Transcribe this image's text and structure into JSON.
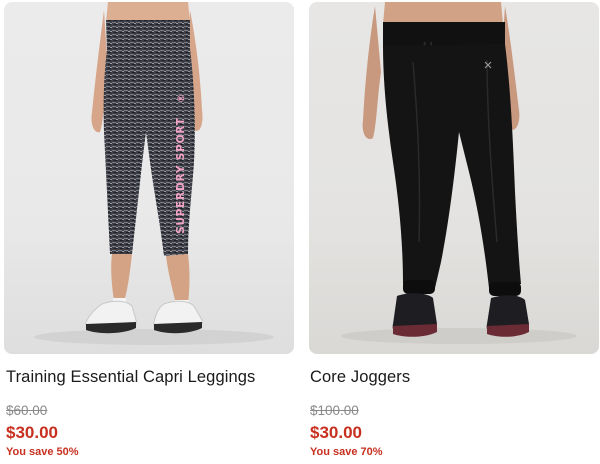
{
  "products": [
    {
      "name": "Training Essential Capri Leggings",
      "was_price": "$60.00",
      "price": "$30.00",
      "savings": "You save 50%",
      "print_text": "SUPERDRY SPORT",
      "registered_mark": "®"
    },
    {
      "name": "Core Joggers",
      "was_price": "$100.00",
      "price": "$30.00",
      "savings": "You save 70%"
    }
  ],
  "colors": {
    "sale": "#c72f1f",
    "strikethrough": "#8a8a8a",
    "title": "#1a1a1a",
    "leggings_print": "#f3a2c8"
  }
}
